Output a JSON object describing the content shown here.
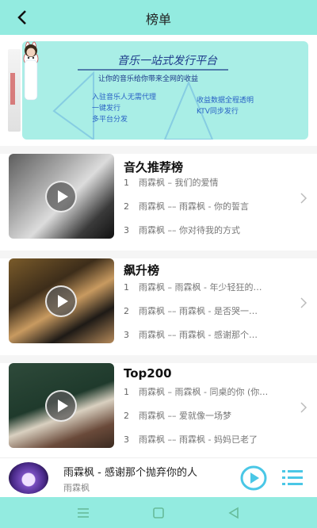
{
  "header": {
    "title": "榜单"
  },
  "banner": {
    "title": "音乐一站式发行平台",
    "subtitle": "让你的音乐给你带来全网的收益",
    "left_lines": [
      "入驻音乐人无需代理",
      "一键发行",
      "多平台分发"
    ],
    "right_lines": [
      "收益数据全程透明",
      "KTV同步发行"
    ]
  },
  "charts": [
    {
      "title": "音久推荐榜",
      "rows": [
        {
          "num": "1",
          "text": "雨霖枫 – 我们的爱情"
        },
        {
          "num": "2",
          "text": "雨霖枫 –– 雨霖枫 - 你的誓言"
        },
        {
          "num": "3",
          "text": "雨霖枫 –– 你对待我的方式"
        }
      ]
    },
    {
      "title": "飙升榜",
      "rows": [
        {
          "num": "1",
          "text": "雨霖枫 – 雨霖枫 - 年少轻狂的…"
        },
        {
          "num": "2",
          "text": "雨霖枫 –– 雨霖枫 - 是否哭一…"
        },
        {
          "num": "3",
          "text": "雨霖枫 –– 雨霖枫 - 感谢那个…"
        }
      ]
    },
    {
      "title": "Top200",
      "rows": [
        {
          "num": "1",
          "text": "雨霖枫 – 雨霖枫 - 同桌的你 (你…"
        },
        {
          "num": "2",
          "text": "雨霖枫 –– 爱就像一场梦"
        },
        {
          "num": "3",
          "text": "雨霖枫 –– 雨霖枫 - 妈妈已老了"
        }
      ]
    }
  ],
  "player": {
    "song": "雨霖枫 - 感谢那个抛弃你的人",
    "artist": "雨霖枫"
  },
  "colors": {
    "accent": "#93ebe0",
    "icon": "#4ac7e6"
  },
  "icons": {
    "back": "back-arrow-icon",
    "play": "play-circle-icon",
    "list": "playlist-icon"
  }
}
